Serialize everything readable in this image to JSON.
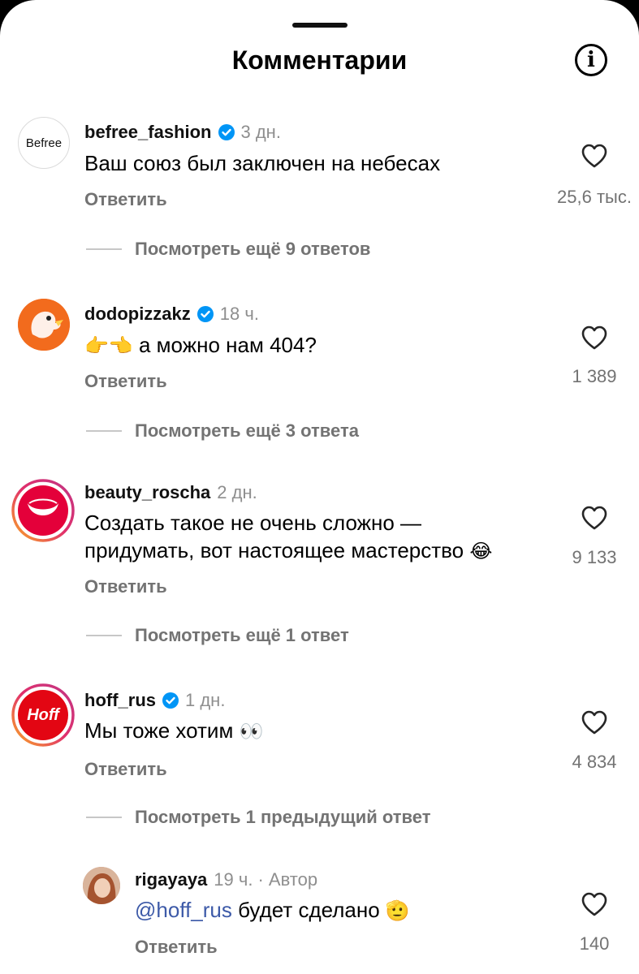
{
  "header": {
    "title": "Комментарии",
    "info_icon": "i"
  },
  "comments": [
    {
      "username": "befree_fashion",
      "avatar_text": "Befree",
      "time": "3 дн.",
      "text": "Ваш союз был заключен на небесах",
      "reply": "Ответить",
      "likes": "25,6 тыс.",
      "more_replies": "Посмотреть ещё 9 ответов"
    },
    {
      "username": "dodopizzakz",
      "time": "18 ч.",
      "emoji": "👉👈",
      "text": "а можно нам 404?",
      "reply": "Ответить",
      "likes": "1 389",
      "more_replies": "Посмотреть ещё 3 ответа"
    },
    {
      "username": "beauty_roscha",
      "time": "2 дн.",
      "text_line1": "Создать такое не очень сложно —",
      "text_line2": "придумать, вот настоящее мастерство",
      "emoji": "😂",
      "reply": "Ответить",
      "likes": "9 133",
      "more_replies": "Посмотреть ещё 1 ответ"
    },
    {
      "username": "hoff_rus",
      "avatar_text": "Hoff",
      "time": "1 дн.",
      "text": "Мы тоже хотим",
      "emoji": "👀",
      "reply": "Ответить",
      "likes": "4 834",
      "more_replies": "Посмотреть 1 предыдущий ответ"
    }
  ],
  "nested_reply": {
    "username": "rigayaya",
    "time": "19 ч.",
    "author_tag": "· Автор",
    "mention": "@hoff_rus",
    "text": "будет сделано",
    "emoji": "🫡",
    "reply": "Ответить",
    "likes": "140"
  },
  "colors": {
    "verified": "#0095f6",
    "secondary_text": "#737373",
    "mention": "#3d5aa8"
  }
}
